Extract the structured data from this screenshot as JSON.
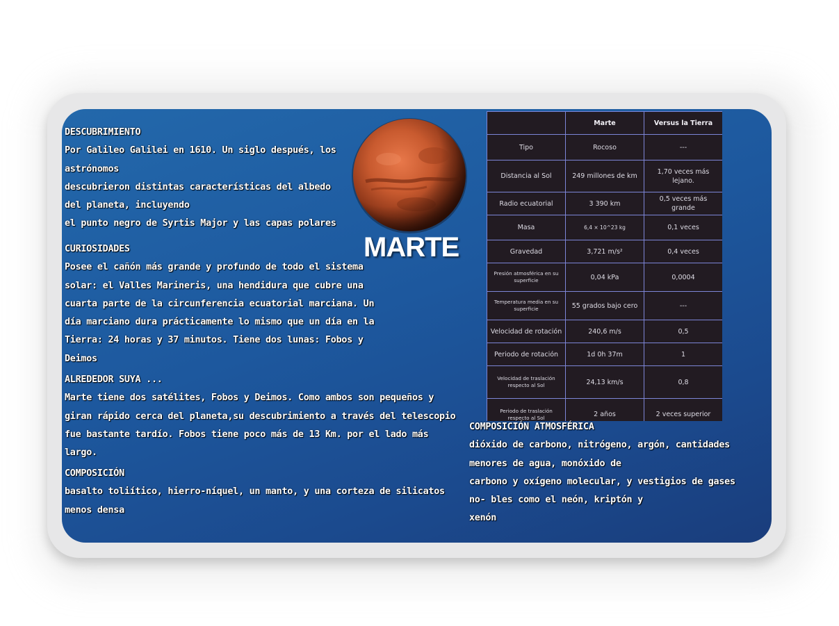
{
  "title": "MARTE",
  "sections": {
    "discovery": {
      "heading": "DESCUBRIMIENTO",
      "lines": [
        "Por Galileo Galilei en 1610. Un siglo después, los",
        "astrónomos",
        "descubrieron distintas características del albedo",
        "del planeta, incluyendo",
        "el punto negro de Syrtis Major y las capas polares"
      ]
    },
    "curiosities": {
      "heading": "CURIOSIDADES",
      "lines": [
        "Posee el cañón más grande y profundo de todo el sistema",
        "solar: el Valles Marineris, una hendidura que cubre una",
        "cuarta parte de la circunferencia ecuatorial marciana. Un",
        "día marciano dura prácticamente lo mismo que un día en la",
        "Tierra: 24 horas y 37 minutos. Tiene dos lunas: Fobos y",
        "Deimos"
      ]
    },
    "around": {
      "heading": "ALREDEDOR SUYA ...",
      "lines": [
        "Marte tiene dos satélites, Fobos y Deimos. Como ambos son pequeños y",
        "giran rápido cerca del planeta,su descubrimiento a través del telescopio",
        "fue bastante tardío. Fobos tiene poco más de 13 Km. por el lado más",
        "largo."
      ]
    },
    "composition": {
      "heading": "COMPOSICIÓN",
      "lines": [
        "basalto toliítico, hierro-níquel, un manto, y una corteza de silicatos",
        "menos densa"
      ]
    },
    "atmosphere": {
      "heading": "COMPOSICIÓN ATMOSFÉRICA",
      "lines": [
        "dióxido de carbono, nitrógeno, argón, cantidades",
        "menores de agua, monóxido de",
        "carbono y oxígeno molecular, y vestigios de gases",
        "no- bles como el neón, kriptón y",
        "xenón"
      ]
    }
  },
  "table": {
    "headers": [
      "",
      "Marte",
      "Versus la Tierra"
    ],
    "rows": [
      {
        "label": "Tipo",
        "mars": "Rocoso",
        "earth": "---"
      },
      {
        "label": "Distancia al Sol",
        "mars": "249 millones de km",
        "earth": "1,70 veces más lejano."
      },
      {
        "label": "Radio ecuatorial",
        "mars": "3 390 km",
        "earth": "0,5 veces más grande"
      },
      {
        "label": "Masa",
        "mars": "6,4 × 10^23 kg",
        "earth": "0,1 veces"
      },
      {
        "label": "Gravedad",
        "mars": "3,721 m/s²",
        "earth": "0,4 veces"
      },
      {
        "label": "Presión atmosférica en su superficie",
        "mars": "0,04 kPa",
        "earth": "0,0004"
      },
      {
        "label": "Temperatura media en su superficie",
        "mars": "55 grados bajo cero",
        "earth": "---"
      },
      {
        "label": "Velocidad de rotación",
        "mars": "240,6 m/s",
        "earth": "0,5"
      },
      {
        "label": "Periodo de rotación",
        "mars": "1d 0h 37m",
        "earth": "1"
      },
      {
        "label": "Velocidad de traslación respecto al Sol",
        "mars": "24,13 km/s",
        "earth": "0,8"
      },
      {
        "label": "Periodo de traslación respecto al Sol",
        "mars": "2 años",
        "earth": "2 veces superior"
      }
    ]
  },
  "colors": {
    "panel_top": "#2368ab",
    "panel_bottom": "#1a3d7c",
    "table_bg": "#221b22",
    "table_border": "#7d86d8",
    "frame": "#e7e7e8"
  }
}
